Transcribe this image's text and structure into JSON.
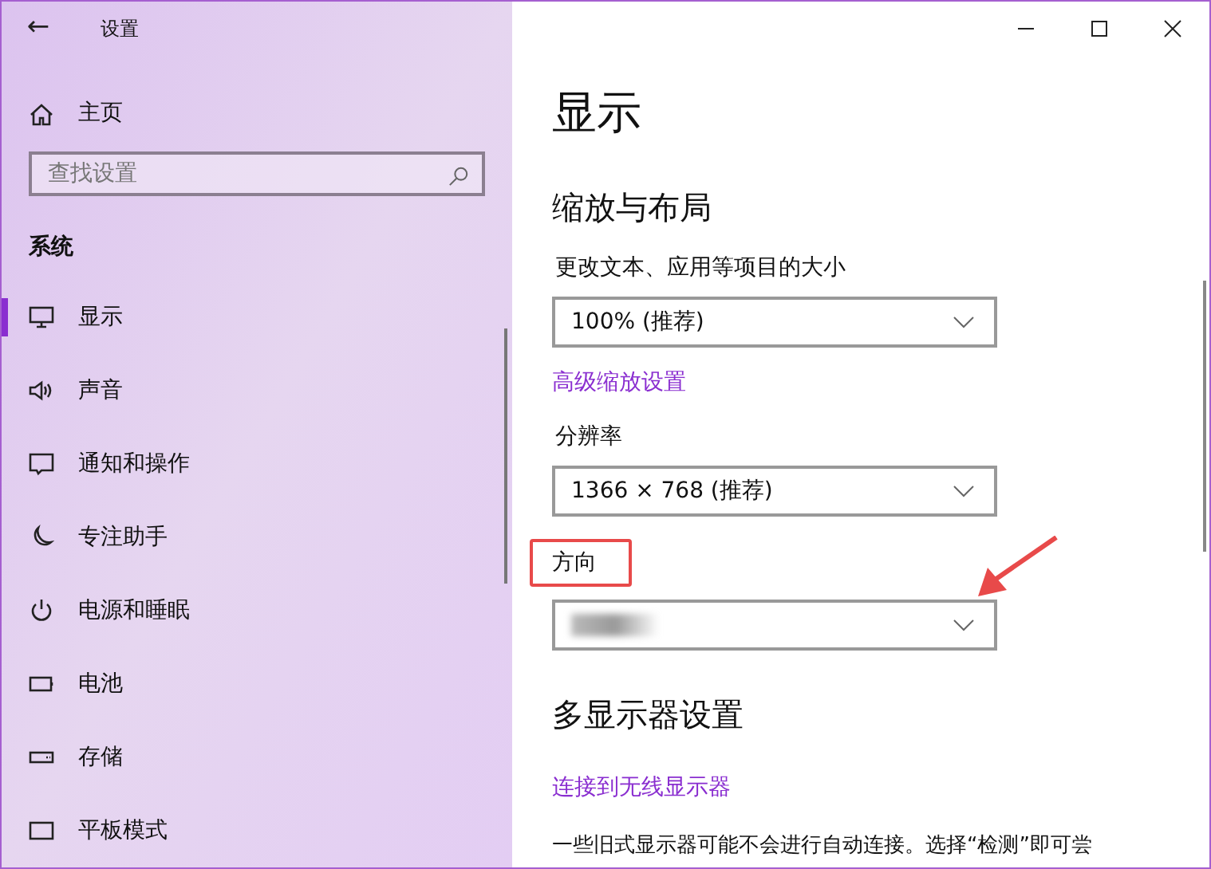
{
  "window": {
    "title": "设置",
    "back": "←"
  },
  "sidebar": {
    "home": "主页",
    "search": {
      "placeholder": "查找设置"
    },
    "section": "系统",
    "items": [
      {
        "label": "显示",
        "kind": "monitor",
        "selected": true
      },
      {
        "label": "声音",
        "kind": "speaker",
        "selected": false
      },
      {
        "label": "通知和操作",
        "kind": "message",
        "selected": false
      },
      {
        "label": "专注助手",
        "kind": "moon",
        "selected": false
      },
      {
        "label": "电源和睡眠",
        "kind": "power",
        "selected": false
      },
      {
        "label": "电池",
        "kind": "battery",
        "selected": false
      },
      {
        "label": "存储",
        "kind": "drive",
        "selected": false
      },
      {
        "label": "平板模式",
        "kind": "tablet",
        "selected": false
      }
    ]
  },
  "content": {
    "title": "显示",
    "sections": [
      {
        "heading": "缩放与布局",
        "rows": [
          {
            "kind": "label",
            "text": "更改文本、应用等项目的大小"
          },
          {
            "kind": "dropdown",
            "value": "100% (推荐)"
          },
          {
            "kind": "link",
            "text": "高级缩放设置"
          },
          {
            "kind": "label",
            "text": "分辨率"
          },
          {
            "kind": "dropdown",
            "value": "1366 × 768 (推荐)"
          },
          {
            "kind": "label",
            "text": "方向",
            "highlighted": true
          },
          {
            "kind": "dropdown",
            "blurred": true,
            "pointed": true
          }
        ]
      },
      {
        "heading": "多显示器设置",
        "rows": [
          {
            "kind": "link",
            "text": "连接到无线显示器"
          },
          {
            "kind": "text",
            "text": "一些旧式显示器可能不会进行自动连接。选择“检测”即可尝"
          }
        ]
      }
    ]
  }
}
